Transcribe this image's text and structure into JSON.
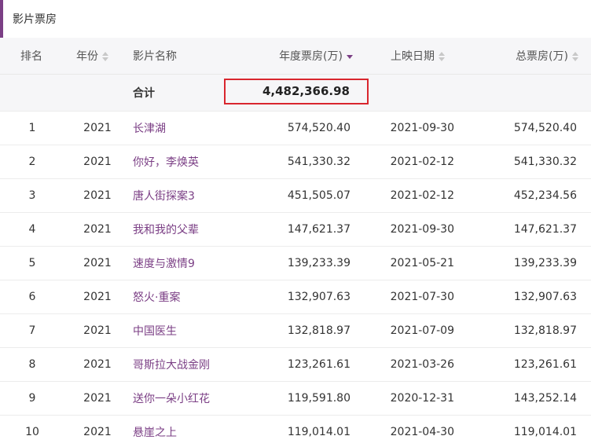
{
  "section": {
    "title": "影片票房"
  },
  "table": {
    "headers": {
      "rank": "排名",
      "year": "年份",
      "title": "影片名称",
      "annual_box_office": "年度票房(万)",
      "release_date": "上映日期",
      "total_box_office": "总票房(万)"
    },
    "sort": {
      "active_column": "annual_box_office",
      "direction": "desc"
    },
    "total": {
      "label": "合计",
      "value": "4,482,366.98"
    },
    "rows": [
      {
        "rank": "1",
        "year": "2021",
        "title": "长津湖",
        "annual": "574,520.40",
        "date": "2021-09-30",
        "total": "574,520.40"
      },
      {
        "rank": "2",
        "year": "2021",
        "title": "你好，李焕英",
        "annual": "541,330.32",
        "date": "2021-02-12",
        "total": "541,330.32"
      },
      {
        "rank": "3",
        "year": "2021",
        "title": "唐人街探案3",
        "annual": "451,505.07",
        "date": "2021-02-12",
        "total": "452,234.56"
      },
      {
        "rank": "4",
        "year": "2021",
        "title": "我和我的父辈",
        "annual": "147,621.37",
        "date": "2021-09-30",
        "total": "147,621.37"
      },
      {
        "rank": "5",
        "year": "2021",
        "title": "速度与激情9",
        "annual": "139,233.39",
        "date": "2021-05-21",
        "total": "139,233.39"
      },
      {
        "rank": "6",
        "year": "2021",
        "title": "怒火·重案",
        "annual": "132,907.63",
        "date": "2021-07-30",
        "total": "132,907.63"
      },
      {
        "rank": "7",
        "year": "2021",
        "title": "中国医生",
        "annual": "132,818.97",
        "date": "2021-07-09",
        "total": "132,818.97"
      },
      {
        "rank": "8",
        "year": "2021",
        "title": "哥斯拉大战金刚",
        "annual": "123,261.61",
        "date": "2021-03-26",
        "total": "123,261.61"
      },
      {
        "rank": "9",
        "year": "2021",
        "title": "送你一朵小红花",
        "annual": "119,591.80",
        "date": "2020-12-31",
        "total": "143,252.14"
      },
      {
        "rank": "10",
        "year": "2021",
        "title": "悬崖之上",
        "annual": "119,014.01",
        "date": "2021-04-30",
        "total": "119,014.01"
      }
    ]
  },
  "colors": {
    "accent": "#7b3f85",
    "highlight_border": "#d9262e",
    "header_bg": "#f6f6f8"
  }
}
